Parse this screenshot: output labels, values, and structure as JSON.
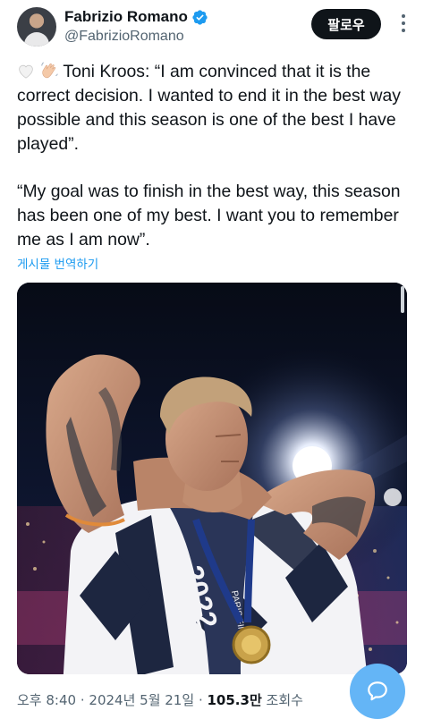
{
  "author": {
    "name": "Fabrizio Romano",
    "handle": "@FabrizioRomano",
    "verified_icon": "verified-badge-icon",
    "follow_label": "팔로우"
  },
  "tweet": {
    "paragraph1": "Toni Kroos: “I am convinced that it is the correct decision. I wanted to end it in the best way possible and this season is one of the best I have played”.",
    "paragraph2": "“My goal was to finish in the best way, this season has been one of my best. I want you to remember me as I am now”.",
    "translate_label": "게시물 번역하기",
    "emojis": [
      "white-heart-icon",
      "waving-hand-icon"
    ]
  },
  "photo": {
    "jersey_text": "2022",
    "ribbon_text": "PARIS FINAL"
  },
  "meta": {
    "time": "오후 8:40",
    "date": "2024년 5월 21일",
    "views_value": "105.3만",
    "views_label": "조회수",
    "separator": "·"
  },
  "colors": {
    "accent": "#1d9bf0",
    "fab": "#64b5f6",
    "follow_bg": "#0f1419",
    "secondary_text": "#536471"
  }
}
